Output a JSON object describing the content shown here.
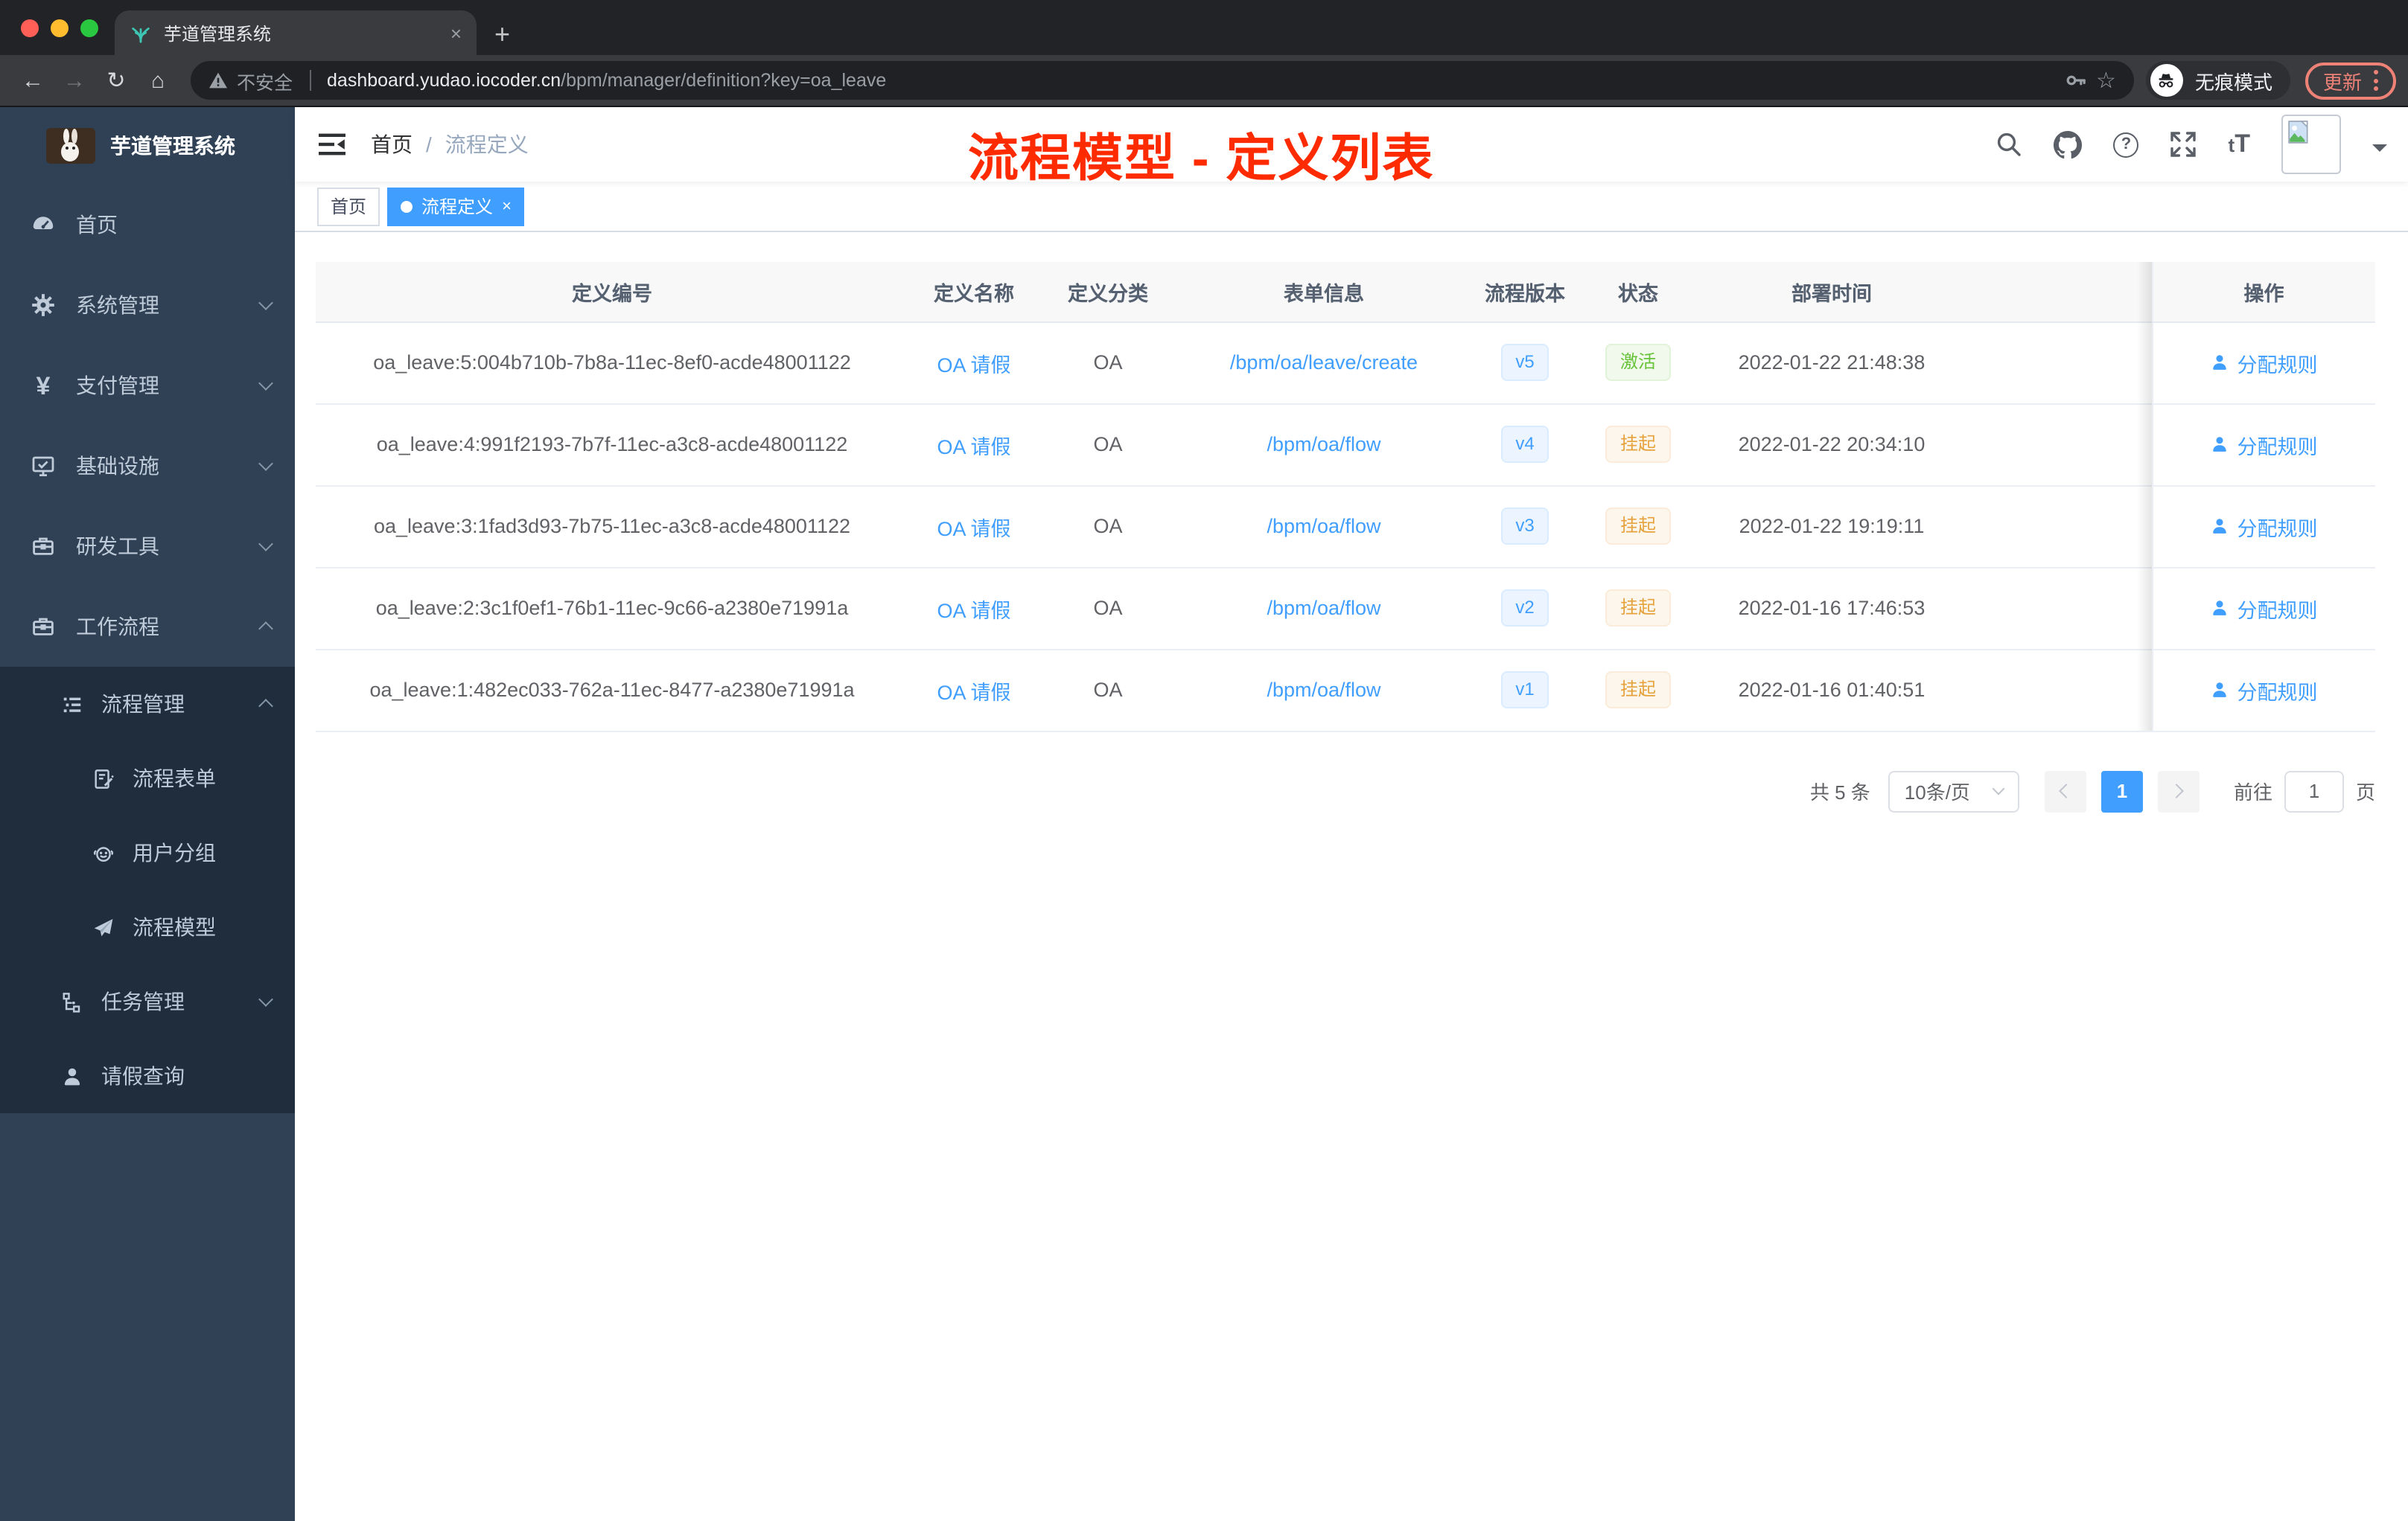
{
  "browser": {
    "traffic_lights": [
      "#ff5f57",
      "#febc2e",
      "#2ac840"
    ],
    "tab": {
      "title": "芋道管理系统",
      "close": "×",
      "favicon": "seedling-icon"
    },
    "new_tab": "+",
    "toolbar": {
      "back": "←",
      "forward": "→",
      "reload": "↻",
      "home": "⌂"
    },
    "url": {
      "security": "不安全",
      "host": "dashboard.yudao.iocoder.cn",
      "path": "/bpm/manager/definition?key=oa_leave"
    },
    "incognito_label": "无痕模式",
    "update_label": "更新"
  },
  "sidebar": {
    "logo_title": "芋道管理系统",
    "menu": [
      {
        "label": "首页",
        "icon": "gauge-icon"
      },
      {
        "label": "系统管理",
        "icon": "gear-icon",
        "chevron": "down"
      },
      {
        "label": "支付管理",
        "icon": "yuan-icon",
        "chevron": "down"
      },
      {
        "label": "基础设施",
        "icon": "monitor-icon",
        "chevron": "down"
      },
      {
        "label": "研发工具",
        "icon": "toolbox-icon",
        "chevron": "down"
      },
      {
        "label": "工作流程",
        "icon": "briefcase-icon",
        "chevron": "up"
      }
    ],
    "submenu": [
      {
        "label": "流程管理",
        "icon": "list-icon",
        "chevron": "up"
      },
      {
        "label": "流程表单",
        "icon": "form-icon"
      },
      {
        "label": "用户分组",
        "icon": "robot-icon"
      },
      {
        "label": "流程模型",
        "icon": "send-icon"
      },
      {
        "label": "任务管理",
        "icon": "tree-icon",
        "chevron": "down"
      },
      {
        "label": "请假查询",
        "icon": "person-icon"
      }
    ]
  },
  "header": {
    "breadcrumb": {
      "home": "首页",
      "separator": "/",
      "current": "流程定义"
    },
    "annotation": "流程模型 - 定义列表"
  },
  "tags": [
    {
      "label": "首页",
      "active": false
    },
    {
      "label": "流程定义",
      "active": true,
      "close": "×"
    }
  ],
  "table": {
    "columns": {
      "id": "定义编号",
      "name": "定义名称",
      "category": "定义分类",
      "form": "表单信息",
      "version": "流程版本",
      "status": "状态",
      "deploy_time": "部署时间",
      "actions": "操作"
    },
    "rows": [
      {
        "id": "oa_leave:5:004b710b-7b8a-11ec-8ef0-acde48001122",
        "name": "OA 请假",
        "category": "OA",
        "form": "/bpm/oa/leave/create",
        "version": "v5",
        "status": "激活",
        "status_type": "active",
        "deploy_time": "2022-01-22 21:48:38",
        "action": "分配规则"
      },
      {
        "id": "oa_leave:4:991f2193-7b7f-11ec-a3c8-acde48001122",
        "name": "OA 请假",
        "category": "OA",
        "form": "/bpm/oa/flow",
        "version": "v4",
        "status": "挂起",
        "status_type": "suspended",
        "deploy_time": "2022-01-22 20:34:10",
        "action": "分配规则"
      },
      {
        "id": "oa_leave:3:1fad3d93-7b75-11ec-a3c8-acde48001122",
        "name": "OA 请假",
        "category": "OA",
        "form": "/bpm/oa/flow",
        "version": "v3",
        "status": "挂起",
        "status_type": "suspended",
        "deploy_time": "2022-01-22 19:19:11",
        "action": "分配规则"
      },
      {
        "id": "oa_leave:2:3c1f0ef1-76b1-11ec-9c66-a2380e71991a",
        "name": "OA 请假",
        "category": "OA",
        "form": "/bpm/oa/flow",
        "version": "v2",
        "status": "挂起",
        "status_type": "suspended",
        "deploy_time": "2022-01-16 17:46:53",
        "action": "分配规则"
      },
      {
        "id": "oa_leave:1:482ec033-762a-11ec-8477-a2380e71991a",
        "name": "OA 请假",
        "category": "OA",
        "form": "/bpm/oa/flow",
        "version": "v1",
        "status": "挂起",
        "status_type": "suspended",
        "deploy_time": "2022-01-16 01:40:51",
        "action": "分配规则"
      }
    ]
  },
  "pagination": {
    "total": "共 5 条",
    "page_size": "10条/页",
    "current_page": "1",
    "goto_label": "前往",
    "goto_value": "1",
    "page_unit": "页"
  },
  "colors": {
    "accent": "#409eff",
    "status_active": "#67c23a",
    "status_suspended": "#e6a23c",
    "annotation": "#ff2b00"
  }
}
